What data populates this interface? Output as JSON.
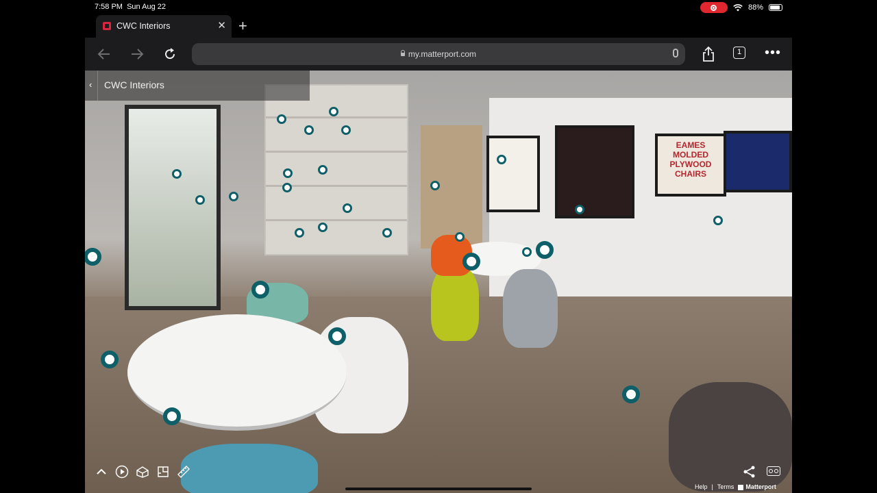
{
  "status_bar": {
    "time": "7:58 PM",
    "date": "Sun Aug 22",
    "battery": "88%",
    "battery_level": 0.88
  },
  "browser": {
    "tab_title": "CWC Interiors",
    "close_glyph": "✕",
    "new_tab_glyph": "+",
    "url": "my.matterport.com",
    "tab_count": "1",
    "more_glyph": "•••"
  },
  "viewer": {
    "space_title": "CWC Interiors",
    "back_glyph": "‹",
    "footer": {
      "help": "Help",
      "separator": "|",
      "terms": "Terms",
      "brand": "Matterport"
    },
    "poster_text": "EAMES\nMOLDED\nPLYWOOD\nCHAIRS"
  },
  "colors": {
    "tag_ring": "#0f5f68",
    "favicon": "#d9253f",
    "record": "#e0262e"
  },
  "icons": [
    "back-arrow-icon",
    "forward-arrow-icon",
    "reload-icon",
    "lock-icon",
    "microphone-icon",
    "share-icon",
    "more-icon",
    "chevron-up-icon",
    "play-icon",
    "dollhouse-icon",
    "floorplan-icon",
    "measure-icon",
    "vr-icon"
  ]
}
